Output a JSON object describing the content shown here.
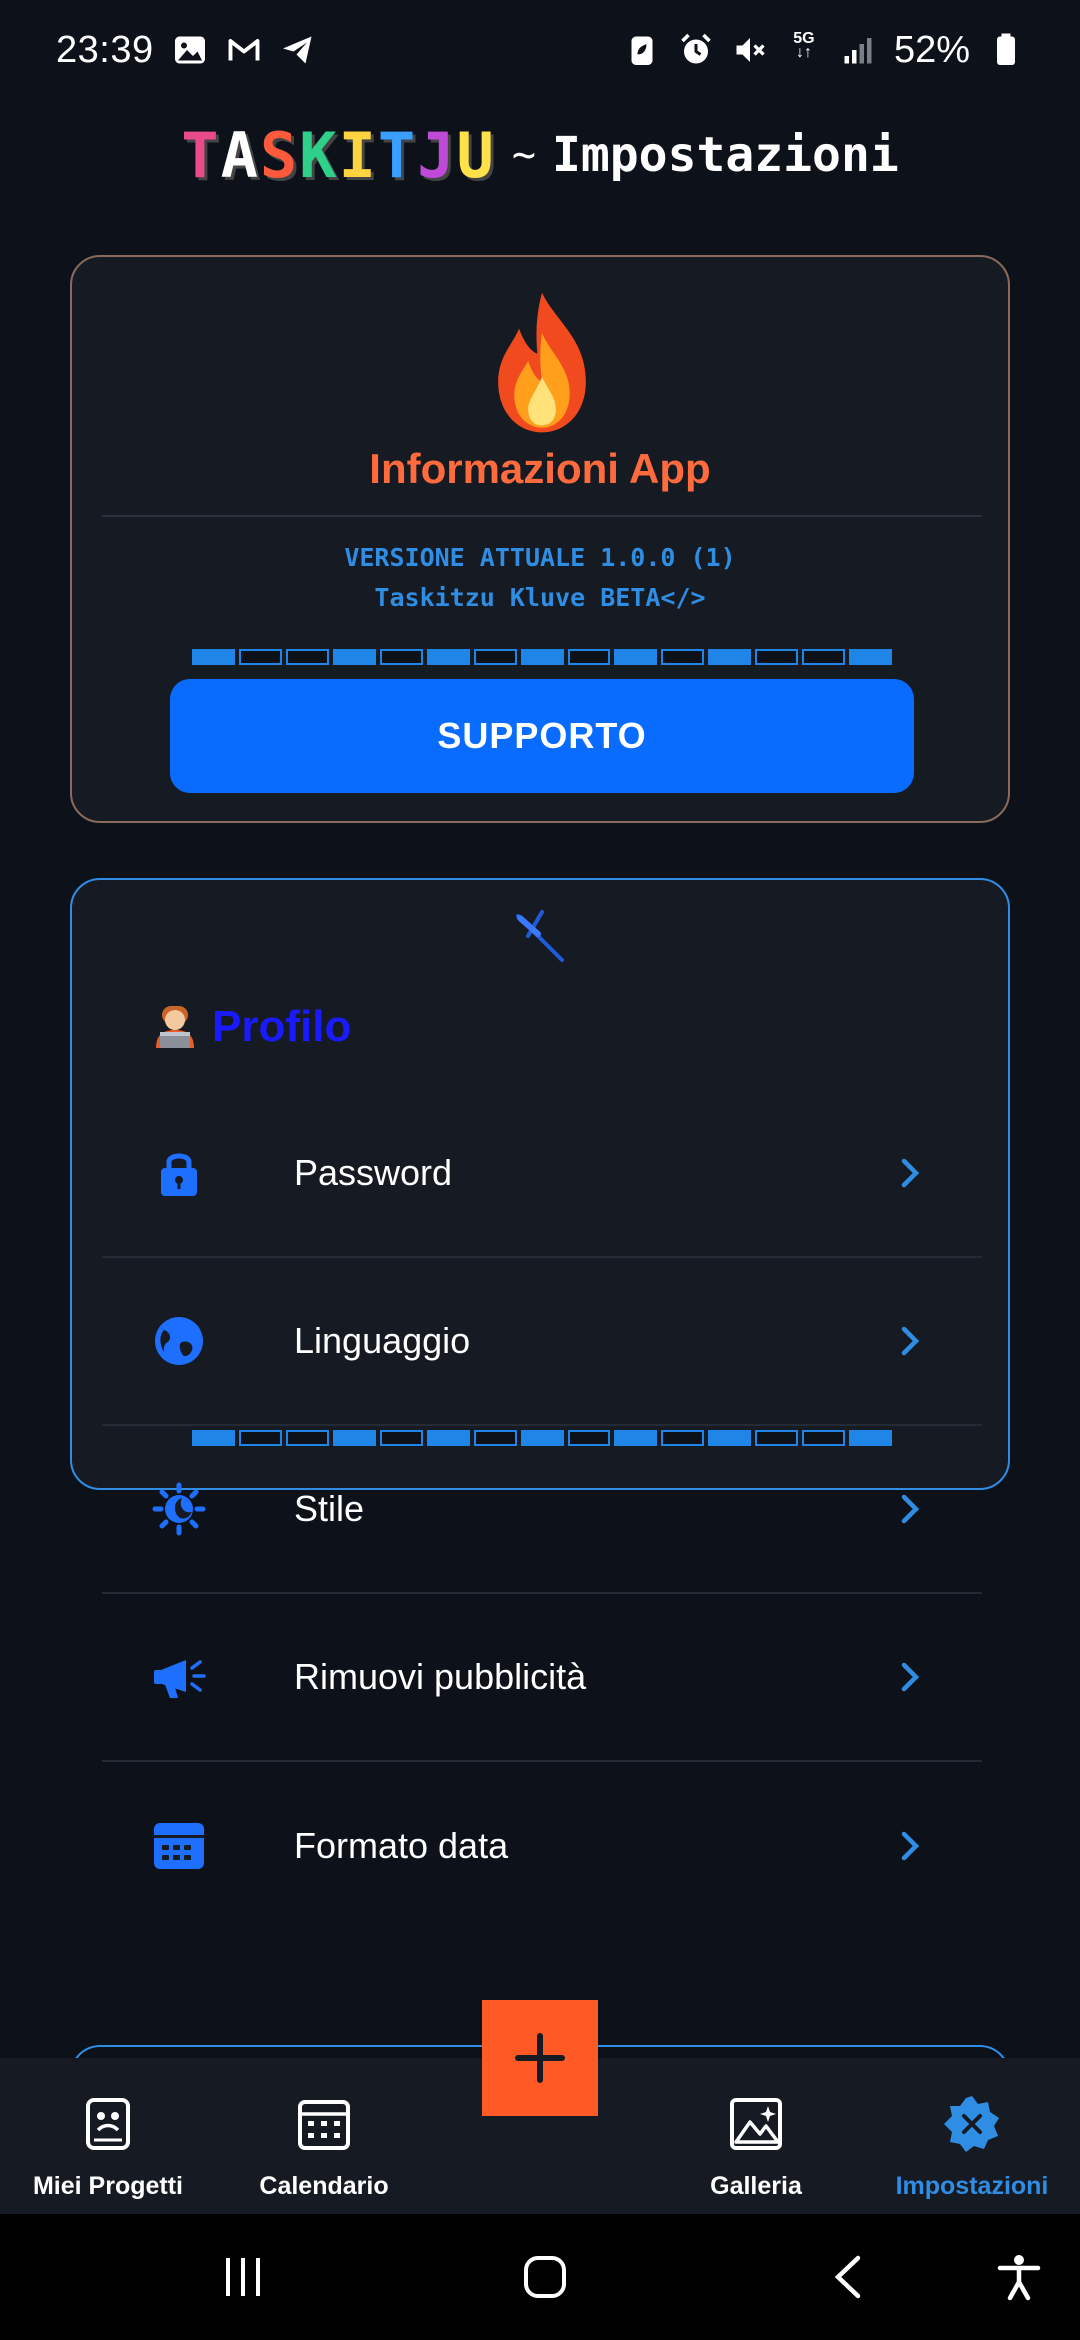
{
  "status_bar": {
    "time": "23:39",
    "network": "5G",
    "battery": "52%",
    "left_icons": [
      "image-icon",
      "gmail-icon",
      "telegram-icon"
    ],
    "right_icons": [
      "battery-saver-icon",
      "alarm-icon",
      "mute-icon",
      "5g-icon",
      "signal-icon",
      "battery-icon"
    ]
  },
  "header": {
    "logo": "TASKITJU",
    "separator": "~",
    "title": "Impostazioni"
  },
  "info_card": {
    "icon": "flame-icon",
    "title": "Informazioni App",
    "version_line": "VERSIONE ATTUALE 1.0.0 (1)",
    "build_line": "Taskitzu Kluve BETA</>",
    "support_button": "SUPPORTO"
  },
  "profile_card": {
    "icon": "hammer-icon",
    "title": "Profilo",
    "items": [
      {
        "label": "Password",
        "icon": "lock-icon"
      },
      {
        "label": "Linguaggio",
        "icon": "globe-icon"
      },
      {
        "label": "Stile",
        "icon": "theme-icon"
      },
      {
        "label": "Rimuovi pubblicità",
        "icon": "megaphone-icon"
      },
      {
        "label": "Formato data",
        "icon": "calendar-icon"
      }
    ]
  },
  "bottom_nav": {
    "items": [
      {
        "label": "Miei Progetti",
        "icon": "projects-icon",
        "active": false
      },
      {
        "label": "Calendario",
        "icon": "calendar-nav-icon",
        "active": false
      },
      {
        "label": "Galleria",
        "icon": "gallery-icon",
        "active": false
      },
      {
        "label": "Impostazioni",
        "icon": "settings-icon",
        "active": true
      }
    ],
    "fab": "plus-icon"
  },
  "colors": {
    "background": "#0d121a",
    "card": "#161b23",
    "accent_blue": "#0a6cff",
    "accent_orange": "#ff6b3d",
    "profile_title": "#1a1aff",
    "fab": "#ff5a26"
  }
}
